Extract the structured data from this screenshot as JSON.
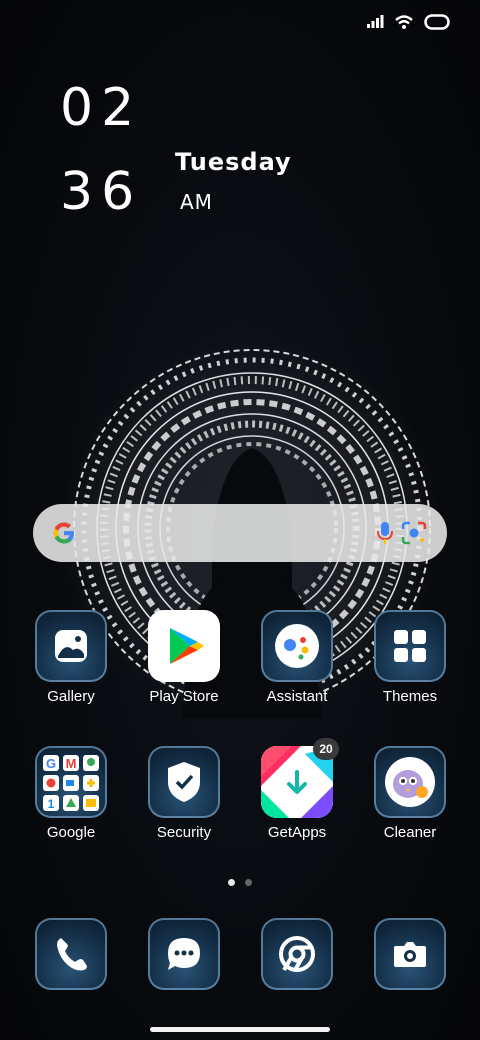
{
  "clock": {
    "hour": "02",
    "minute": "36",
    "day": "Tuesday",
    "ampm": "AM"
  },
  "search": {
    "engine_icon": "google-g-icon",
    "mic_icon": "mic-icon",
    "lens_icon": "lens-icon"
  },
  "apps_row1": [
    {
      "label": "Gallery",
      "icon": "gallery-icon"
    },
    {
      "label": "Play Store",
      "icon": "play-store-icon"
    },
    {
      "label": "Assistant",
      "icon": "assistant-icon"
    },
    {
      "label": "Themes",
      "icon": "themes-icon"
    }
  ],
  "apps_row2": [
    {
      "label": "Google",
      "icon": "google-folder-icon"
    },
    {
      "label": "Security",
      "icon": "security-icon"
    },
    {
      "label": "GetApps",
      "icon": "getapps-icon",
      "badge": "20"
    },
    {
      "label": "Cleaner",
      "icon": "cleaner-icon"
    }
  ],
  "dock": [
    {
      "icon": "phone-icon"
    },
    {
      "icon": "messages-icon"
    },
    {
      "icon": "chrome-icon"
    },
    {
      "icon": "camera-icon"
    }
  ],
  "pages": {
    "count": 2,
    "active": 0
  },
  "colors": {
    "tile_border": "#8cbee6",
    "tile_bg": "#143049",
    "background": "#07090d"
  }
}
